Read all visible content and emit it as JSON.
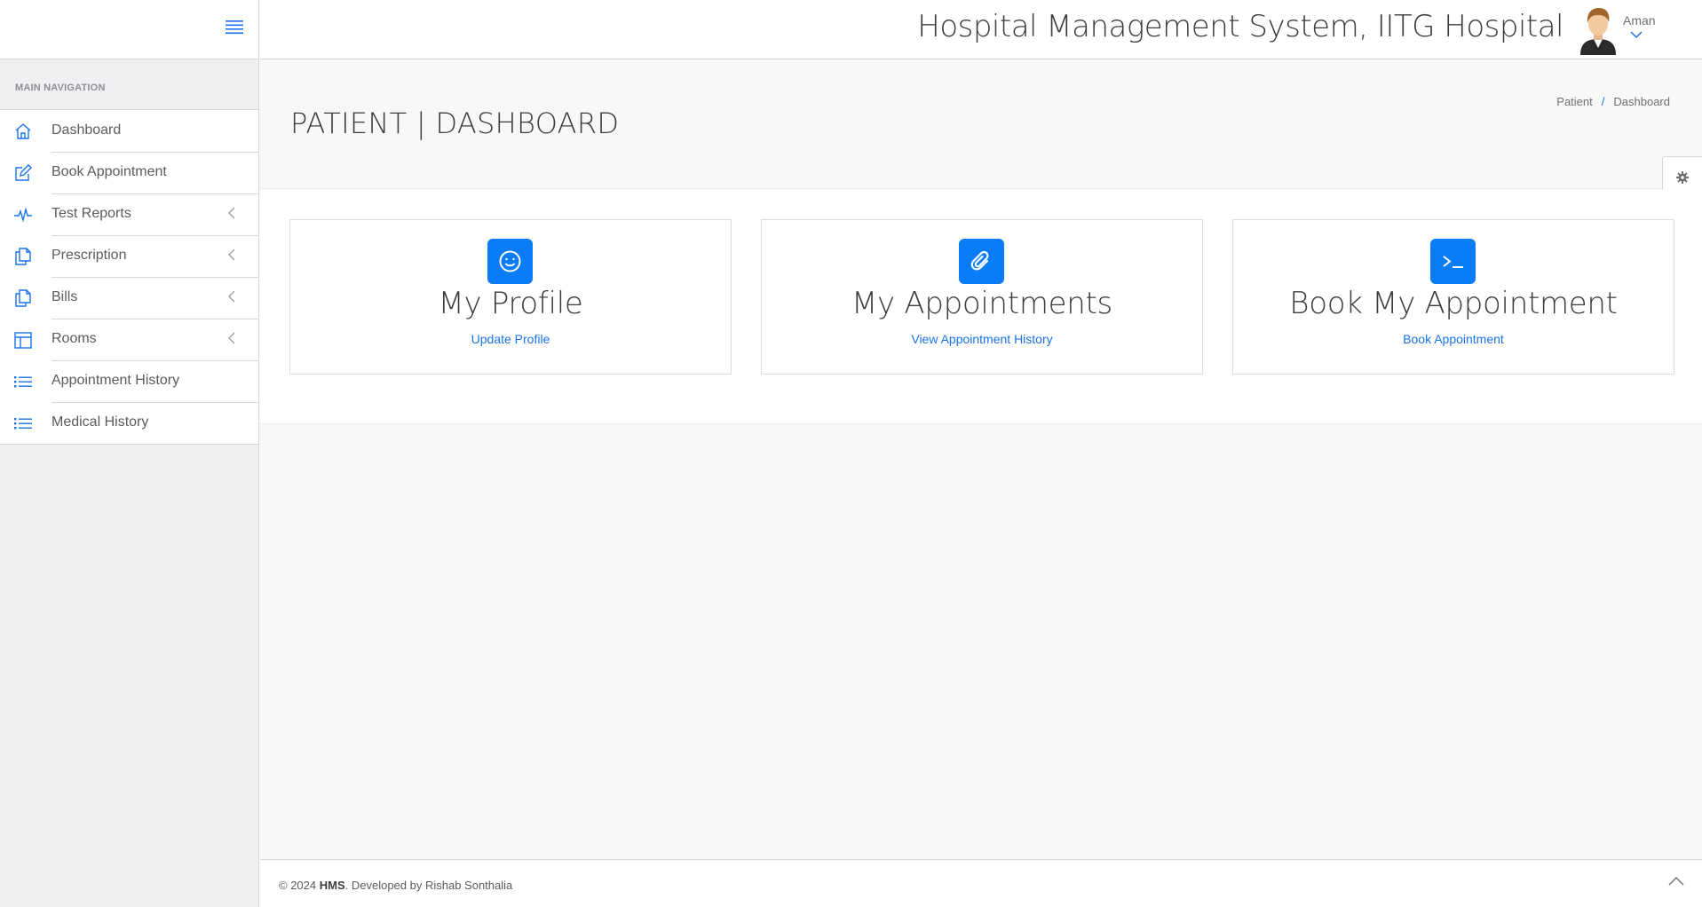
{
  "header": {
    "title": "Hospital Management System, IITG Hospital",
    "user_name": "Aman"
  },
  "sidebar": {
    "heading": "MAIN NAVIGATION",
    "items": [
      {
        "label": "Dashboard",
        "icon": "home-icon"
      },
      {
        "label": "Book Appointment",
        "icon": "edit-icon"
      },
      {
        "label": "Test Reports",
        "icon": "pulse-icon",
        "has_submenu": true
      },
      {
        "label": "Prescription",
        "icon": "documents-icon",
        "has_submenu": true
      },
      {
        "label": "Bills",
        "icon": "documents-icon",
        "has_submenu": true
      },
      {
        "label": "Rooms",
        "icon": "layout-icon",
        "has_submenu": true
      },
      {
        "label": "Appointment History",
        "icon": "list-icon"
      },
      {
        "label": "Medical History",
        "icon": "list-icon"
      }
    ]
  },
  "page": {
    "title": "PATIENT | DASHBOARD",
    "breadcrumb": [
      "Patient",
      "Dashboard"
    ]
  },
  "cards": [
    {
      "title": "My Profile",
      "link": "Update Profile",
      "icon": "smiley-icon"
    },
    {
      "title": "My Appointments",
      "link": "View Appointment History",
      "icon": "paperclip-icon"
    },
    {
      "title": "Book My Appointment",
      "link": "Book Appointment",
      "icon": "terminal-icon"
    }
  ],
  "footer": {
    "year": "© 2024",
    "brand": "HMS",
    "credit": ". Developed by Rishab Sonthalia"
  },
  "colors": {
    "accent": "#0a7cf5",
    "link": "#1a73e8",
    "sidebar_bg": "#f0f0f2"
  }
}
